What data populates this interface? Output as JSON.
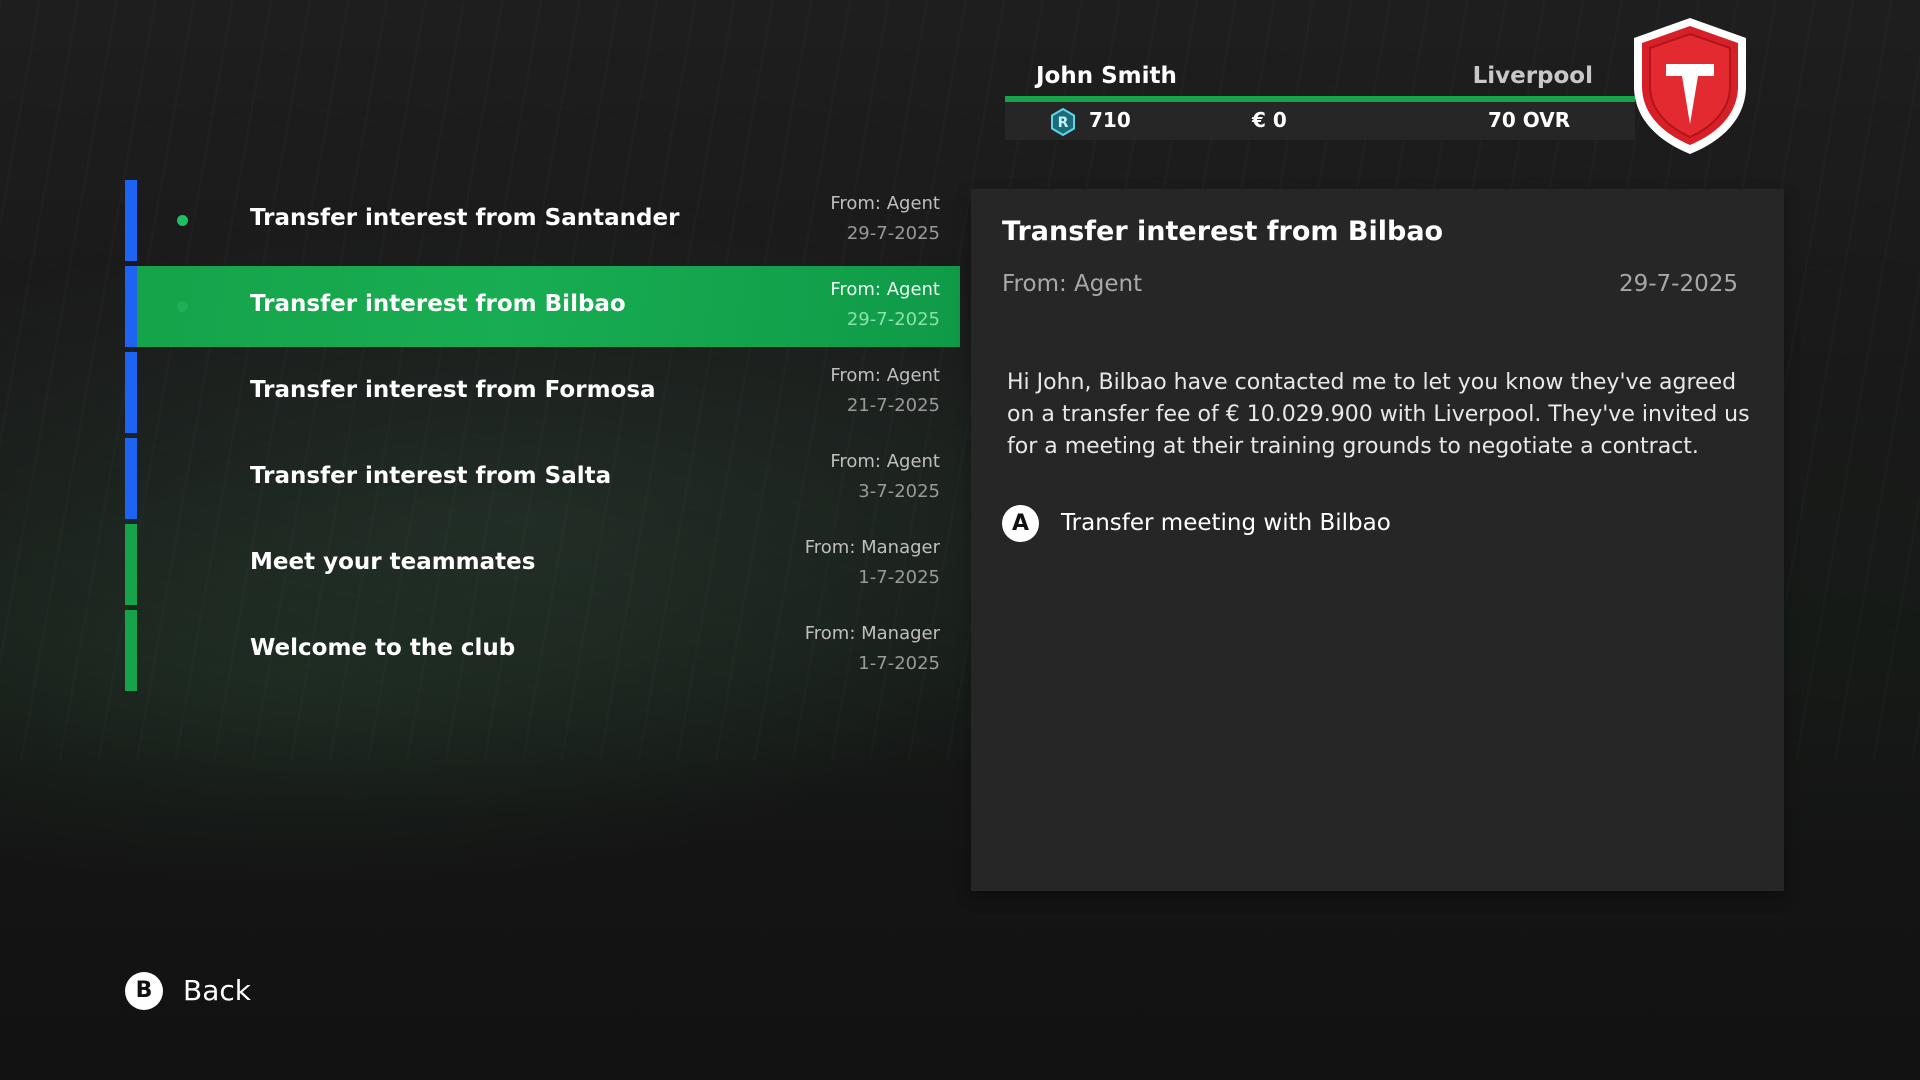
{
  "player": {
    "name": "John Smith",
    "club": "Liverpool",
    "rating_points": "710",
    "rating_icon": "r-coin-icon",
    "money": "€ 0",
    "overall": "70 OVR",
    "crest_icon": "club-crest-shield-icon"
  },
  "inbox": {
    "messages": [
      {
        "subject": "Transfer interest from Santander",
        "from": "From: Agent",
        "date": "29-7-2025",
        "unread": true,
        "category_color": "#1d64f2"
      },
      {
        "subject": "Transfer interest from Bilbao",
        "from": "From: Agent",
        "date": "29-7-2025",
        "unread": true,
        "selected": true,
        "category_color": "#1d64f2"
      },
      {
        "subject": "Transfer interest from Formosa",
        "from": "From: Agent",
        "date": "21-7-2025",
        "unread": false,
        "category_color": "#1d64f2"
      },
      {
        "subject": "Transfer interest from Salta",
        "from": "From: Agent",
        "date": "3-7-2025",
        "unread": false,
        "category_color": "#1d64f2"
      },
      {
        "subject": "Meet your teammates",
        "from": "From: Manager",
        "date": "1-7-2025",
        "unread": false,
        "category_color": "#16a34a"
      },
      {
        "subject": "Welcome to the club",
        "from": "From: Manager",
        "date": "1-7-2025",
        "unread": false,
        "category_color": "#16a34a"
      }
    ]
  },
  "detail": {
    "title": "Transfer interest from Bilbao",
    "from": "From: Agent",
    "date": "29-7-2025",
    "body": "Hi John, Bilbao have contacted me to let you know they've agreed on a transfer fee of € 10.029.900 with Liverpool. They've invited us for a meeting at their training grounds to negotiate a contract.",
    "action": {
      "button": "A",
      "label": "Transfer meeting with Bilbao"
    }
  },
  "footer": {
    "back": {
      "button": "B",
      "label": "Back"
    }
  },
  "colors": {
    "accent_green": "#16a34a",
    "category_blue": "#1d64f2",
    "panel": "#262626"
  }
}
